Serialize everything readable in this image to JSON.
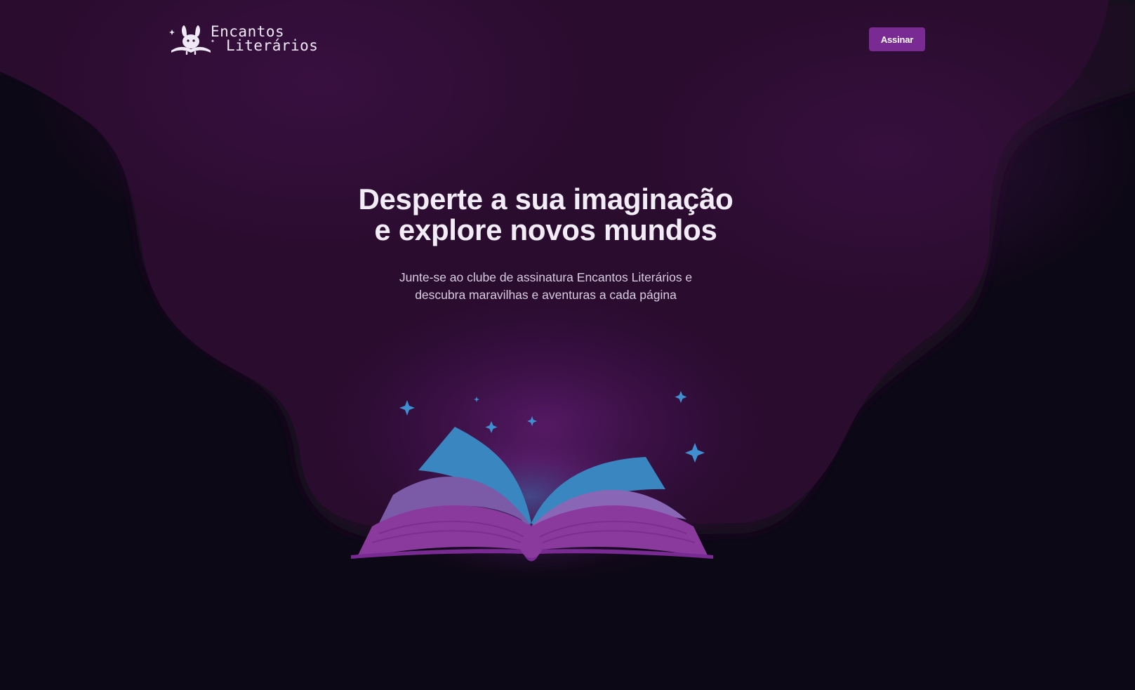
{
  "header": {
    "brand_line1": "Encantos",
    "brand_line2": "Literários",
    "subscribe_label": "Assinar"
  },
  "hero": {
    "title_line1": "Desperte a sua imaginação",
    "title_line2": "e explore novos mundos",
    "subtitle_line1": "Junte-se ao clube de assinatura Encantos Literários e",
    "subtitle_line2": "descubra maravilhas e aventuras a cada página"
  },
  "colors": {
    "background_dark": "#0d0816",
    "background_purple": "#2a0c2e",
    "accent_button": "#7a2a93",
    "book_purple": "#8a3a9c",
    "book_pages_blue": "#3a86c0",
    "sparkle_blue": "#3f8fd0",
    "text_light": "#f1ecf6"
  },
  "icons": {
    "logo": "rabbit-reading-book-icon",
    "illustration": "open-book-icon",
    "sparkles": "sparkle-icon"
  }
}
